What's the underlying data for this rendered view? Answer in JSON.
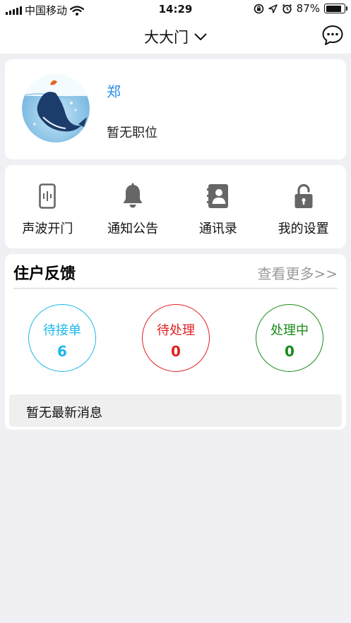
{
  "status_bar": {
    "carrier": "中国移动",
    "time": "14:29",
    "battery_percent": "87%",
    "battery_level": 0.87,
    "icons": [
      "signal-icon",
      "wifi-icon",
      "rotation-lock-icon",
      "location-icon",
      "alarm-icon",
      "battery-icon"
    ]
  },
  "nav": {
    "title": "大大门",
    "dropdown_icon": "chevron-down-icon",
    "chat_icon": "chat-bubble-icon"
  },
  "profile": {
    "name": "郑",
    "position": "暂无职位",
    "avatar_icon": "whale-avatar"
  },
  "menu": {
    "items": [
      {
        "label": "声波开门",
        "icon": "sound-phone-icon"
      },
      {
        "label": "通知公告",
        "icon": "bell-icon"
      },
      {
        "label": "通讯录",
        "icon": "contacts-book-icon"
      },
      {
        "label": "我的设置",
        "icon": "unlock-icon"
      }
    ]
  },
  "feedback": {
    "title": "住户反馈",
    "more_link": "查看更多>>",
    "stats": [
      {
        "label": "待接单",
        "value": "6",
        "color": "#1cb7e8"
      },
      {
        "label": "待处理",
        "value": "0",
        "color": "#e02020"
      },
      {
        "label": "处理中",
        "value": "0",
        "color": "#198a1a"
      }
    ],
    "news_text": "暂无最新消息"
  },
  "colors": {
    "accent_blue": "#2a8ee8",
    "page_background": "#efeff4",
    "more_link_gray": "#9a9a9a"
  }
}
